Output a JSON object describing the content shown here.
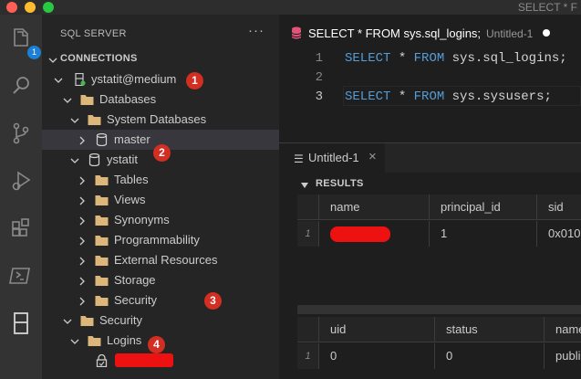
{
  "window": {
    "title": "SELECT * F"
  },
  "activity_bar": {
    "items": [
      {
        "icon": "files-icon",
        "badge": "1"
      },
      {
        "icon": "search-icon"
      },
      {
        "icon": "source-control-icon"
      },
      {
        "icon": "run-debug-icon"
      },
      {
        "icon": "extensions-icon"
      },
      {
        "icon": "terminal-icon"
      },
      {
        "icon": "server-icon"
      }
    ]
  },
  "sidebar": {
    "title": "SQL SERVER",
    "more": "···",
    "section": "CONNECTIONS",
    "tree": [
      {
        "label": "ystatit@medium",
        "icon": "server-icon",
        "expanded": true,
        "marker": "1"
      },
      {
        "label": "Databases",
        "icon": "folder-icon",
        "expanded": true
      },
      {
        "label": "System Databases",
        "icon": "folder-icon",
        "expanded": true
      },
      {
        "label": "master",
        "icon": "database-icon",
        "expanded": false
      },
      {
        "label": "ystatit",
        "icon": "database-icon",
        "expanded": true,
        "marker": "2"
      },
      {
        "label": "Tables",
        "icon": "folder-icon",
        "expanded": false
      },
      {
        "label": "Views",
        "icon": "folder-icon",
        "expanded": false
      },
      {
        "label": "Synonyms",
        "icon": "folder-icon",
        "expanded": false
      },
      {
        "label": "Programmability",
        "icon": "folder-icon",
        "expanded": false
      },
      {
        "label": "External Resources",
        "icon": "folder-icon",
        "expanded": false
      },
      {
        "label": "Storage",
        "icon": "folder-icon",
        "expanded": false
      },
      {
        "label": "Security",
        "icon": "folder-icon",
        "expanded": false,
        "marker": "3"
      },
      {
        "label": "Security",
        "icon": "folder-icon",
        "expanded": true
      },
      {
        "label": "Logins",
        "icon": "folder-icon",
        "expanded": true,
        "marker": "4"
      },
      {
        "label": "",
        "icon": "login-lock-icon",
        "redacted": true
      }
    ]
  },
  "editor": {
    "tab_title": "SELECT * FROM sys.sql_logins;",
    "tab_subtitle": "Untitled-1",
    "lines": [
      {
        "number": "1",
        "keyword1": "SELECT",
        "middle": " * ",
        "keyword2": "FROM",
        "rest": " sys.sql_logins;"
      },
      {
        "number": "2",
        "keyword1": "",
        "middle": "",
        "keyword2": "",
        "rest": ""
      },
      {
        "number": "3",
        "keyword1": "SELECT",
        "middle": " * ",
        "keyword2": "FROM",
        "rest": " sys.sysusers;"
      }
    ]
  },
  "panel": {
    "tab_title": "Untitled-1",
    "close": "×",
    "results_label": "RESULTS",
    "grid1": {
      "columns": [
        "name",
        "principal_id",
        "sid"
      ],
      "rows": [
        {
          "row_num": "1",
          "name": "",
          "name_redacted": true,
          "principal_id": "1",
          "sid": "0x010"
        }
      ]
    },
    "grid2": {
      "columns": [
        "uid",
        "status",
        "name"
      ],
      "rows": [
        {
          "row_num": "1",
          "uid": "0",
          "status": "0",
          "name": "publi"
        }
      ]
    }
  },
  "colors": {
    "accent": "#1b80d6",
    "marker": "#d22e22",
    "redaction": "#ee1111",
    "folder": "#dcb67a"
  }
}
